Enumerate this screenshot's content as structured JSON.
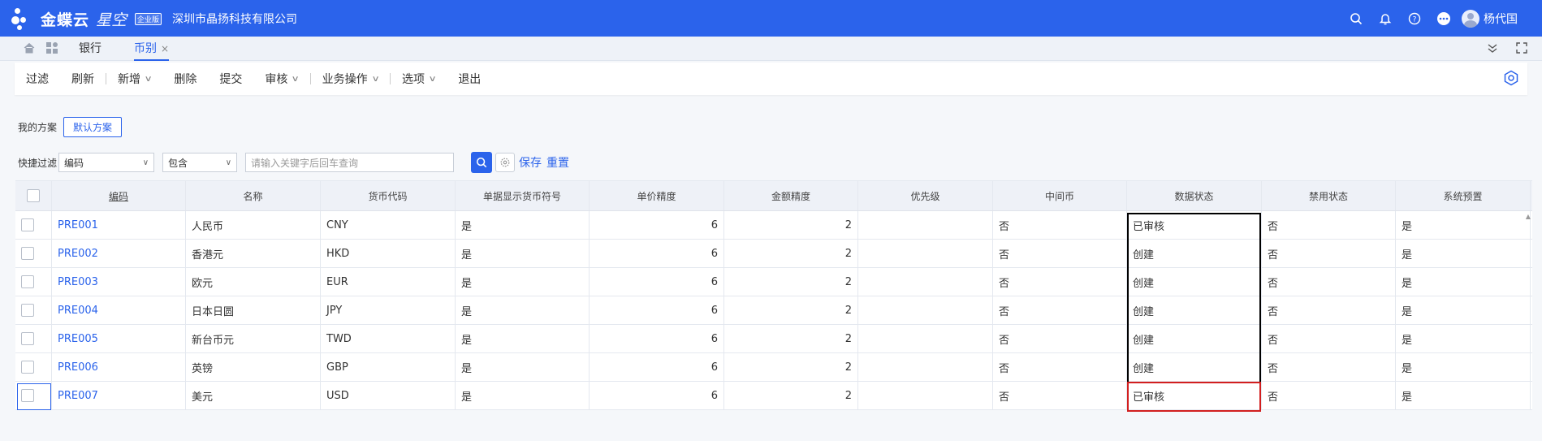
{
  "app": {
    "brand": "金蝶云",
    "brand_sub": "星空",
    "edition": "企业版",
    "company": "深圳市晶扬科技有限公司",
    "user": "杨代国"
  },
  "tabs": [
    {
      "label": "银行"
    },
    {
      "label": "币别",
      "close": "×"
    }
  ],
  "toolbar": {
    "items": [
      "过滤",
      "刷新",
      "新增",
      "删除",
      "提交",
      "审核",
      "业务操作",
      "选项",
      "退出"
    ]
  },
  "scheme": {
    "label": "我的方案",
    "default": "默认方案"
  },
  "filter": {
    "label": "快捷过滤",
    "field": "编码",
    "op": "包含",
    "placeholder": "请输入关键字后回车查询",
    "save": "保存",
    "reset": "重置"
  },
  "table": {
    "headers": [
      "编码",
      "名称",
      "货币代码",
      "单据显示货币符号",
      "单价精度",
      "金额精度",
      "优先级",
      "中间币",
      "数据状态",
      "禁用状态",
      "系统预置"
    ],
    "rows": [
      [
        "PRE001",
        "人民币",
        "CNY",
        "是",
        "6",
        "2",
        "",
        "否",
        "已审核",
        "否",
        "是"
      ],
      [
        "PRE002",
        "香港元",
        "HKD",
        "是",
        "6",
        "2",
        "",
        "否",
        "创建",
        "否",
        "是"
      ],
      [
        "PRE003",
        "欧元",
        "EUR",
        "是",
        "6",
        "2",
        "",
        "否",
        "创建",
        "否",
        "是"
      ],
      [
        "PRE004",
        "日本日圆",
        "JPY",
        "是",
        "6",
        "2",
        "",
        "否",
        "创建",
        "否",
        "是"
      ],
      [
        "PRE005",
        "新台币元",
        "TWD",
        "是",
        "6",
        "2",
        "",
        "否",
        "创建",
        "否",
        "是"
      ],
      [
        "PRE006",
        "英镑",
        "GBP",
        "是",
        "6",
        "2",
        "",
        "否",
        "创建",
        "否",
        "是"
      ],
      [
        "PRE007",
        "美元",
        "USD",
        "是",
        "6",
        "2",
        "",
        "否",
        "已审核",
        "否",
        "是"
      ]
    ]
  },
  "colors": {
    "accent": "#2b63eb",
    "highlight_col": "#000000",
    "highlight_cell": "#d21f1f"
  }
}
